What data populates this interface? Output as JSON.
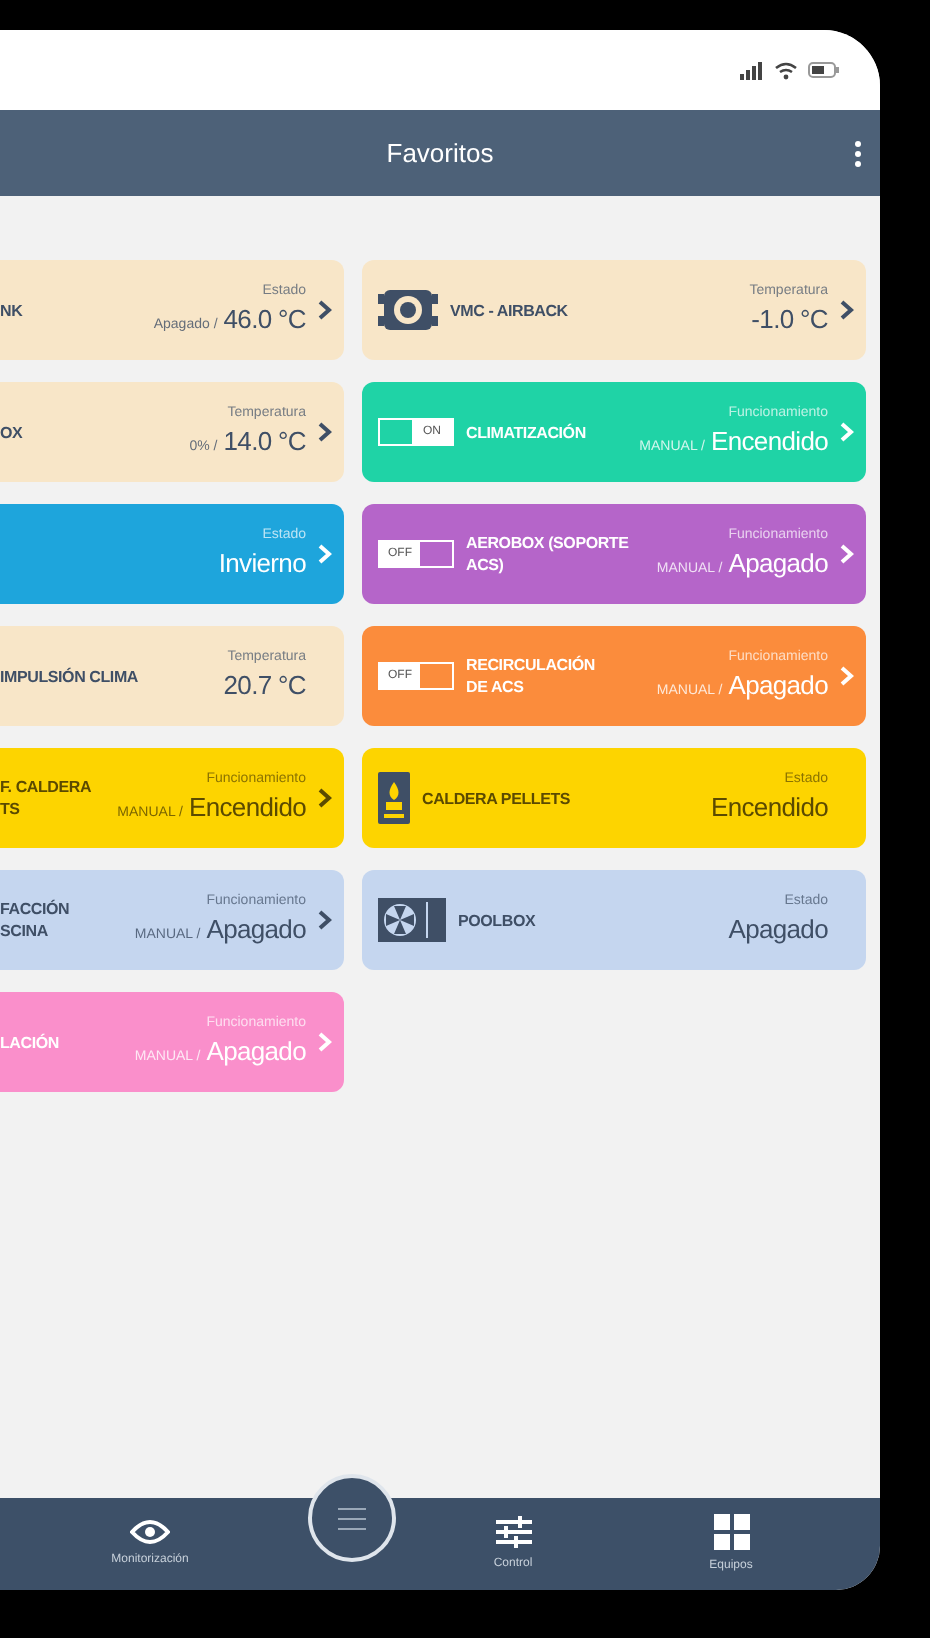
{
  "header": {
    "title": "Favoritos"
  },
  "columns": [
    {
      "cards": [
        {
          "name": "NK",
          "label": "Estado",
          "mode": "Apagado /",
          "value": "46.0 °C",
          "color": "#f8e6c8",
          "chevron": true
        },
        {
          "name": "OX",
          "label": "Temperatura",
          "mode": "0% /",
          "value": "14.0 °C",
          "color": "#f8e6c8",
          "chevron": true
        },
        {
          "label": "Estado",
          "value": "Invierno",
          "color": "#1ea5dc",
          "chevron": true
        },
        {
          "name": "IMPULSIÓN CLIMA",
          "label": "Temperatura",
          "value": "20.7 °C",
          "color": "#f8e6c8",
          "chevron": false
        },
        {
          "name": "F. CALDERA\nTS",
          "label": "Funcionamiento",
          "mode": "MANUAL /",
          "value": "Encendido",
          "color": "#fdd400",
          "chevron": true
        },
        {
          "name": "FACCIÓN\nSCINA",
          "label": "Funcionamiento",
          "mode": "MANUAL /",
          "value": "Apagado",
          "color": "#c5d6ef",
          "chevron": true
        },
        {
          "name": "LACIÓN",
          "label": "Funcionamiento",
          "mode": "MANUAL /",
          "value": "Apagado",
          "color": "#fa8fcb",
          "chevron": true
        }
      ]
    },
    {
      "cards": [
        {
          "kind": "vent",
          "name": "VMC - AIRBACK",
          "label": "Temperatura",
          "value": "-1.0 °C",
          "color": "#f8e6c8",
          "chevron": true
        },
        {
          "toggle": {
            "on": true,
            "label": "ON"
          },
          "name": "CLIMATIZACIÓN",
          "label": "Funcionamiento",
          "mode": "MANUAL /",
          "value": "Encendido",
          "color": "#1fd3a6",
          "chevron": true
        },
        {
          "toggle": {
            "on": false,
            "label": "OFF"
          },
          "name": "AEROBOX (SOPORTE\nACS)",
          "label": "Funcionamiento",
          "mode": "MANUAL /",
          "value": "Apagado",
          "color": "#b565c9",
          "chevron": true
        },
        {
          "toggle": {
            "on": false,
            "label": "OFF"
          },
          "name": "RECIRCULACIÓN\nDE ACS",
          "label": "Funcionamiento",
          "mode": "MANUAL /",
          "value": "Apagado",
          "color": "#fb8c3c",
          "chevron": true
        },
        {
          "kind": "boiler",
          "name": "CALDERA PELLETS",
          "label": "Estado",
          "value": "Encendido",
          "color": "#fdd400",
          "chevron": false
        },
        {
          "kind": "fan",
          "name": "POOLBOX",
          "label": "Estado",
          "value": "Apagado",
          "color": "#c5d6ef",
          "chevron": false
        }
      ]
    }
  ],
  "nav": [
    {
      "kind": "eye",
      "label": "Monitorización"
    },
    {
      "kind": "menu"
    },
    {
      "kind": "sliders",
      "label": "Control"
    },
    {
      "kind": "grid",
      "label": "Equipos"
    }
  ]
}
